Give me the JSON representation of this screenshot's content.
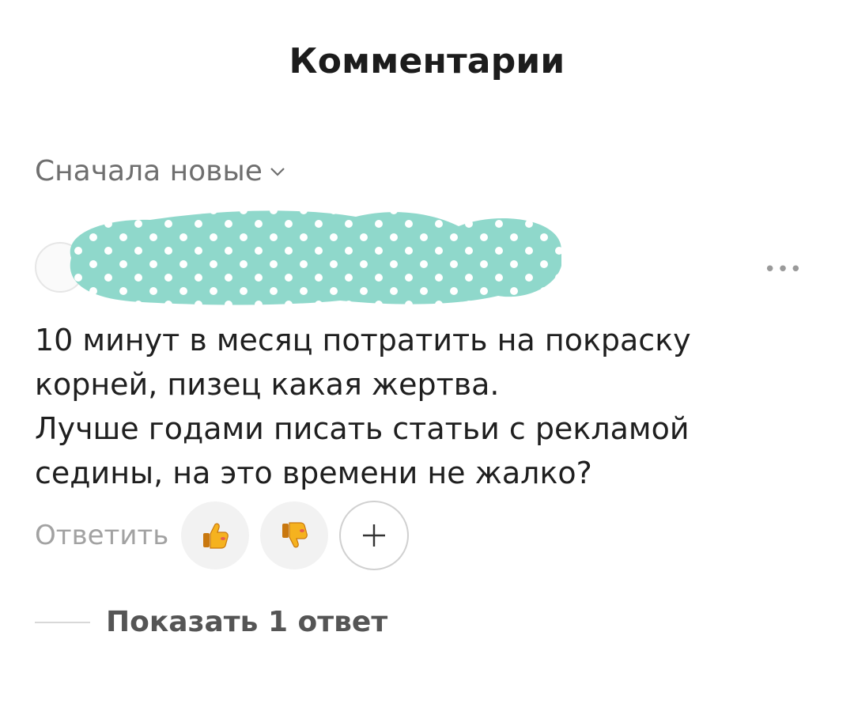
{
  "header": {
    "title": "Комментарии"
  },
  "sort": {
    "label": "Сначала новые",
    "icon": "chevron-down-icon"
  },
  "comment": {
    "menu_icon": "more-dots-icon",
    "menu_glyph": "•••",
    "lines": [
      "10 минут в месяц потратить на покраску",
      "корней, пизец какая жертва.",
      "Лучше годами писать статьи с рекламой",
      "седины, на это времени не жалко?"
    ],
    "reply_label": "Ответить",
    "reactions": [
      {
        "name": "thumbs-up-icon"
      },
      {
        "name": "thumbs-down-icon"
      }
    ],
    "add_reaction_icon": "plus-icon"
  },
  "replies": {
    "label": "Показать 1 ответ"
  },
  "colors": {
    "redaction": "#8fd8cb",
    "dots": "#ffffff",
    "emoji": "#f5b21f"
  }
}
